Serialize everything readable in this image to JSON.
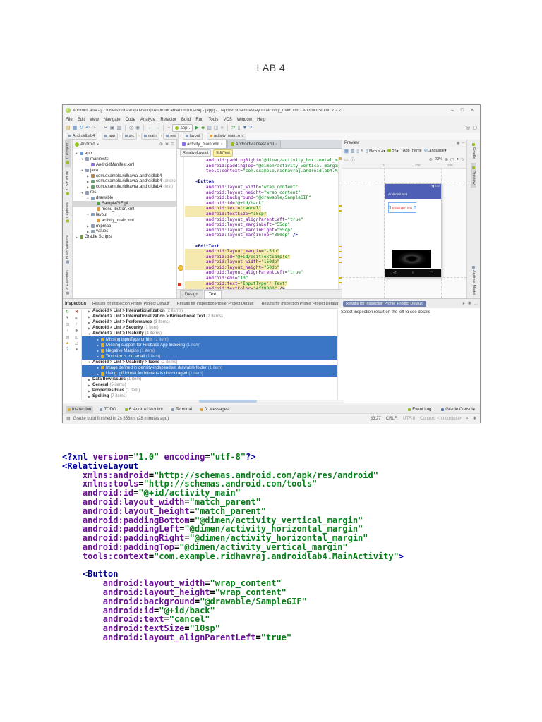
{
  "doc": {
    "title": "LAB 4",
    "code_lines": [
      "<?xml version=\"1.0\" encoding=\"utf-8\"?>",
      "<RelativeLayout",
      "    xmlns:android=\"http://schemas.android.com/apk/res/android\"",
      "    xmlns:tools=\"http://schemas.android.com/tools\"",
      "    android:id=\"@+id/activity_main\"",
      "    android:layout_width=\"match_parent\"",
      "    android:layout_height=\"match_parent\"",
      "    android:paddingBottom=\"@dimen/activity_vertical_margin\"",
      "    android:paddingLeft=\"@dimen/activity_horizontal_margin\"",
      "    android:paddingRight=\"@dimen/activity_horizontal_margin\"",
      "    android:paddingTop=\"@dimen/activity_vertical_margin\"",
      "    tools:context=\"com.example.ridhavraj.androidlab4.MainActivity\">",
      "",
      "    <Button",
      "        android:layout_width=\"wrap_content\"",
      "        android:layout_height=\"wrap_content\"",
      "        android:background=\"@drawable/SampleGIF\"",
      "        android:id=\"@+id/back\"",
      "        android:text=\"cancel\"",
      "        android:textSize=\"10sp\"",
      "        android:layout_alignParentLeft=\"true\""
    ]
  },
  "ide": {
    "window": {
      "title": "AndroidLab4 - [C:\\Users\\ridhavraj\\Desktop\\AndroidLab\\AndroidLab4] - [app] - ..\\app\\src\\main\\res\\layout\\activity_main.xml - Android Studio 2.2.2",
      "controls": [
        "–",
        "□",
        "×"
      ]
    },
    "menus": [
      "File",
      "Edit",
      "View",
      "Navigate",
      "Code",
      "Analyze",
      "Refactor",
      "Build",
      "Run",
      "Tools",
      "VCS",
      "Window",
      "Help"
    ],
    "toolbar": {
      "run_config": "app",
      "icons": [
        {
          "name": "open-icon",
          "glyph": "▤",
          "color": "#c99b3f"
        },
        {
          "name": "save-icon",
          "glyph": "▦",
          "color": "#4a7cb5"
        },
        {
          "name": "sync-icon",
          "glyph": "↻",
          "color": "#4a9bd5"
        },
        {
          "name": "undo-icon",
          "glyph": "↶",
          "color": "#5585c9"
        },
        {
          "name": "redo-icon",
          "glyph": "↷",
          "color": "#9aa7b0"
        },
        {
          "type": "sep"
        },
        {
          "name": "cut-icon",
          "glyph": "✂",
          "color": "#6b7b8a"
        },
        {
          "name": "copy-icon",
          "glyph": "▣",
          "color": "#6b7b8a"
        },
        {
          "name": "paste-icon",
          "glyph": "▥",
          "color": "#6b7b8a"
        },
        {
          "type": "sep"
        },
        {
          "name": "find-icon",
          "glyph": "◎",
          "color": "#6b7b8a"
        },
        {
          "name": "replace-icon",
          "glyph": "◉",
          "color": "#6b7b8a"
        },
        {
          "type": "sep"
        },
        {
          "name": "back-icon",
          "glyph": "←",
          "color": "#3fa7c9"
        },
        {
          "name": "forward-icon",
          "glyph": "→",
          "color": "#3fa7c9"
        },
        {
          "type": "sep"
        },
        {
          "name": "attach-debugger-icon",
          "glyph": "⌁",
          "color": "#888888"
        },
        {
          "type": "config"
        },
        {
          "name": "run-icon",
          "glyph": "▶",
          "color": "#2e9b43"
        },
        {
          "name": "debug-icon",
          "glyph": "◆",
          "color": "#5a9b43"
        },
        {
          "name": "coverage-icon",
          "glyph": "▧",
          "color": "#8a9bae"
        },
        {
          "name": "profile-icon",
          "glyph": "◫",
          "color": "#8a9bae"
        },
        {
          "name": "stop-icon",
          "glyph": "■",
          "color": "#c4c4c4"
        },
        {
          "type": "sep"
        },
        {
          "name": "sync-gradle-icon",
          "glyph": "⇄",
          "color": "#5aae5a"
        },
        {
          "name": "avd-manager-icon",
          "glyph": "▯",
          "color": "#8a9bae"
        },
        {
          "name": "sdk-manager-icon",
          "glyph": "▼",
          "color": "#4a7cb5"
        },
        {
          "name": "help-icon",
          "glyph": "?",
          "color": "#3f74c9"
        }
      ],
      "right_icons": [
        {
          "name": "search-everywhere-icon",
          "glyph": "◎"
        },
        {
          "name": "panel-toggle-icon",
          "glyph": "▢"
        }
      ]
    },
    "breadcrumb": [
      "AndroidLab4",
      "app",
      "src",
      "main",
      "res",
      "layout",
      "activity_main.xml"
    ],
    "left_tabs": [
      {
        "label": "1: Project",
        "sel": true
      },
      {
        "label": "7: Structure",
        "sel": false
      },
      {
        "label": "Captures",
        "sel": false
      }
    ],
    "left_tabs_bottom": [
      {
        "label": "Build Variants",
        "sel": false
      },
      {
        "label": "2: Favorites",
        "sel": false
      }
    ],
    "right_tabs": [
      {
        "label": "Gradle",
        "sel": false
      },
      {
        "label": "Preview",
        "sel": true
      }
    ],
    "right_tabs_bottom": [
      {
        "label": "Android Model",
        "sel": false
      }
    ],
    "project": {
      "selector": "Android",
      "tree": [
        {
          "label": "app",
          "indent": 0,
          "chev": "▼",
          "icon": "#6a9bd8",
          "sel": false
        },
        {
          "label": "manifests",
          "indent": 1,
          "chev": "▼",
          "icon": "#8aa0b8",
          "sel": false
        },
        {
          "label": "AndroidManifest.xml",
          "indent": 2,
          "chev": "",
          "icon": "#8a6ee0",
          "sel": false
        },
        {
          "label": "java",
          "indent": 1,
          "chev": "▼",
          "icon": "#8aa0b8",
          "sel": false
        },
        {
          "label": "com.example.ridhavraj.androidlab4",
          "indent": 2,
          "chev": "▶",
          "icon": "#b08850",
          "sel": false
        },
        {
          "label": "com.example.ridhavraj.androidlab4",
          "suffix": " (androidTest)",
          "indent": 2,
          "chev": "▶",
          "icon": "#6aa06a",
          "sel": false
        },
        {
          "label": "com.example.ridhavraj.androidlab4",
          "suffix": " (test)",
          "indent": 2,
          "chev": "▶",
          "icon": "#6aa06a",
          "sel": false
        },
        {
          "label": "res",
          "indent": 1,
          "chev": "▼",
          "icon": "#8aa0b8",
          "sel": false
        },
        {
          "label": "drawable",
          "indent": 2,
          "chev": "▼",
          "icon": "#8aa0b8",
          "sel": false
        },
        {
          "label": "SampleGIF.gif",
          "indent": 3,
          "chev": "",
          "icon": "#50a050",
          "sel": true
        },
        {
          "label": "menu_button.xml",
          "indent": 3,
          "chev": "",
          "icon": "#e09a3e",
          "sel": false
        },
        {
          "label": "layout",
          "indent": 2,
          "chev": "▼",
          "icon": "#8aa0b8",
          "sel": false
        },
        {
          "label": "activity_main.xml",
          "indent": 3,
          "chev": "",
          "icon": "#e09a3e",
          "sel": false
        },
        {
          "label": "mipmap",
          "indent": 2,
          "chev": "▶",
          "icon": "#8aa0b8",
          "sel": false
        },
        {
          "label": "values",
          "indent": 2,
          "chev": "▶",
          "icon": "#8aa0b8",
          "sel": false
        },
        {
          "label": "Gradle Scripts",
          "indent": 0,
          "chev": "▶",
          "icon": "#729b4a",
          "sel": false
        }
      ]
    },
    "editor": {
      "tabs": [
        {
          "label": "activity_main.xml",
          "sel": true,
          "icon": "#8a6ee0"
        },
        {
          "label": "AndroidManifest.xml",
          "sel": false,
          "icon": "#97c024"
        }
      ],
      "close_glyph": "×",
      "crumbs": [
        {
          "label": "RelativeLayout",
          "sel": false
        },
        {
          "label": "EditText",
          "sel": true
        }
      ],
      "lines": [
        {
          "text": "        android:paddingRight=\"@dimen/activity_horizontal_margin\"",
          "hl": false
        },
        {
          "text": "        android:paddingTop=\"@dimen/activity_vertical_margin\"",
          "hl": false
        },
        {
          "text": "        tools:context=\"com.example.ridhavraj.androidlab4.MainActivity\">",
          "hl": false
        },
        {
          "text": "",
          "hl": false
        },
        {
          "text": "    <Button",
          "hl": false
        },
        {
          "text": "        android:layout_width=\"wrap_content\"",
          "hl": false
        },
        {
          "text": "        android:layout_height=\"wrap_content\"",
          "hl": false
        },
        {
          "text": "        android:background=\"@drawable/SampleGIF\"",
          "hl": false
        },
        {
          "text": "        android:id=\"@+id/back\"",
          "hl": false
        },
        {
          "text": "        android:text=\"cancel\"",
          "hl": true
        },
        {
          "text": "        android:textSize=\"10sp\"",
          "hl": true
        },
        {
          "text": "        android:layout_alignParentLeft=\"true\"",
          "hl": false
        },
        {
          "text": "        android:layout_marginLeft=\"55dp\"",
          "hl": false
        },
        {
          "text": "        android:layout_marginRight=\"55dp\"",
          "hl": false
        },
        {
          "text": "        android:layout_marginTop=\"300dp\" />",
          "hl": false
        },
        {
          "text": "",
          "hl": false
        },
        {
          "text": "    <EditText",
          "hl": false
        },
        {
          "text": "        android:layout_margin=\"-5dp\"",
          "hl": true
        },
        {
          "text": "        android:id=\"@+id/editTextSample\"",
          "hl": true
        },
        {
          "text": "        android:layout_width=\"150dp\"",
          "hl": true
        },
        {
          "text": "        android:layout_height=\"50dp\"",
          "hl": true,
          "bulb": true
        },
        {
          "text": "        android:layout_alignParentLeft=\"true\"",
          "hl": false
        },
        {
          "text": "        android:ems=\"10\"",
          "hl": false
        },
        {
          "text": "        android:text=\"InputType'' Text\"",
          "hl": true
        },
        {
          "text": "        android:textColor=\"#ff0000\" />",
          "hl": true
        }
      ],
      "bottom_tabs": [
        {
          "label": "Design",
          "sel": false
        },
        {
          "label": "Text",
          "sel": true
        }
      ]
    },
    "preview": {
      "title": "Preview",
      "device": "Nexus 4",
      "api": "25",
      "theme": "AppTheme",
      "language": "Language",
      "zoom": "22%",
      "ruler": [
        "0",
        "100",
        "200"
      ],
      "app_title": "AndroidLab4",
      "status_icons": "▾▮ 8:00",
      "edittext_text": "InputType' Text",
      "nav_icons": [
        "◁",
        "○",
        "▢"
      ]
    },
    "inspection": {
      "caption": "Inspection",
      "tabs": [
        {
          "label": "Results for Inspection Profile 'Project Default'",
          "sel": false
        },
        {
          "label": "Results for Inspection Profile 'Project Default'",
          "sel": false
        },
        {
          "label": "Results for Inspection Profile 'Project Default'",
          "sel": false
        },
        {
          "label": "Results for Inspection Profile 'Project Default'",
          "sel": true
        }
      ],
      "rows": [
        {
          "label": "Android > Lint > Internationalization",
          "count": "(2 items)",
          "indent": 0,
          "chev": "▶",
          "grp": true,
          "sel": false
        },
        {
          "label": "Android > Lint > Internationalization > Bidirectional Text",
          "count": "(2 items)",
          "indent": 0,
          "chev": "▶",
          "grp": true,
          "sel": false
        },
        {
          "label": "Android > Lint > Performance",
          "count": "(3 items)",
          "indent": 0,
          "chev": "▶",
          "grp": true,
          "sel": false
        },
        {
          "label": "Android > Lint > Security",
          "count": "(1 item)",
          "indent": 0,
          "chev": "▶",
          "grp": true,
          "sel": false
        },
        {
          "label": "Android > Lint > Usability",
          "count": "(4 items)",
          "indent": 0,
          "chev": "▼",
          "grp": true,
          "sel": false
        },
        {
          "label": "Missing inputType or hint",
          "count": "(1 item)",
          "indent": 1,
          "chev": "▶",
          "grp": false,
          "sel": true,
          "warn": true
        },
        {
          "label": "Missing support for Firebase App Indexing",
          "count": "(1 item)",
          "indent": 1,
          "chev": "▶",
          "grp": false,
          "sel": true,
          "warn": true
        },
        {
          "label": "Negative Margins",
          "count": "(1 item)",
          "indent": 1,
          "chev": "▶",
          "grp": false,
          "sel": true,
          "warn": true
        },
        {
          "label": "Text size is too small",
          "count": "(1 item)",
          "indent": 1,
          "chev": "▶",
          "grp": false,
          "sel": true,
          "warn": true
        },
        {
          "label": "Android > Lint > Usability > Icons",
          "count": "(2 items)",
          "indent": 0,
          "chev": "▼",
          "grp": true,
          "sel": false
        },
        {
          "label": "Image defined in density-independent drawable folder",
          "count": "(1 item)",
          "indent": 1,
          "chev": "▶",
          "grp": false,
          "sel": true,
          "warn": true
        },
        {
          "label": "Using .gif format for bitmaps is discouraged",
          "count": "(1 item)",
          "indent": 1,
          "chev": "▶",
          "grp": false,
          "sel": true,
          "warn": true
        },
        {
          "label": "Data flow issues",
          "count": "(1 item)",
          "indent": 0,
          "chev": "▶",
          "grp": true,
          "sel": false
        },
        {
          "label": "General",
          "count": "(5 items)",
          "indent": 0,
          "chev": "▶",
          "grp": true,
          "sel": false
        },
        {
          "label": "Properties Files",
          "count": "(1 item)",
          "indent": 0,
          "chev": "▶",
          "grp": true,
          "sel": false
        },
        {
          "label": "Spelling",
          "count": "(7 items)",
          "indent": 0,
          "chev": "▶",
          "grp": true,
          "sel": false
        }
      ],
      "details_placeholder": "Select inspection result on the left to see details"
    },
    "bottom_bar": {
      "tabs": [
        {
          "label": "Inspection",
          "sel": true,
          "icon": "#d9b036"
        },
        {
          "label": "TODO",
          "sel": false,
          "icon": "#8a9bae"
        },
        {
          "label": "6: Android Monitor",
          "sel": false,
          "icon": "#97c024"
        },
        {
          "label": "Terminal",
          "sel": false,
          "icon": "#8a9bae"
        },
        {
          "label": "0: Messages",
          "sel": false,
          "icon": "#e0a030"
        }
      ],
      "right": [
        {
          "label": "Event Log",
          "icon": "#97c024"
        },
        {
          "label": "Gradle Console",
          "icon": "#5d83b5"
        }
      ]
    },
    "status": {
      "left": "Gradle build finished in 2s 858ms (28 minutes ago)",
      "position": "33:27",
      "line_sep": "CRLF:",
      "encoding": "UTF-8",
      "context": "Context: <no context>"
    }
  }
}
